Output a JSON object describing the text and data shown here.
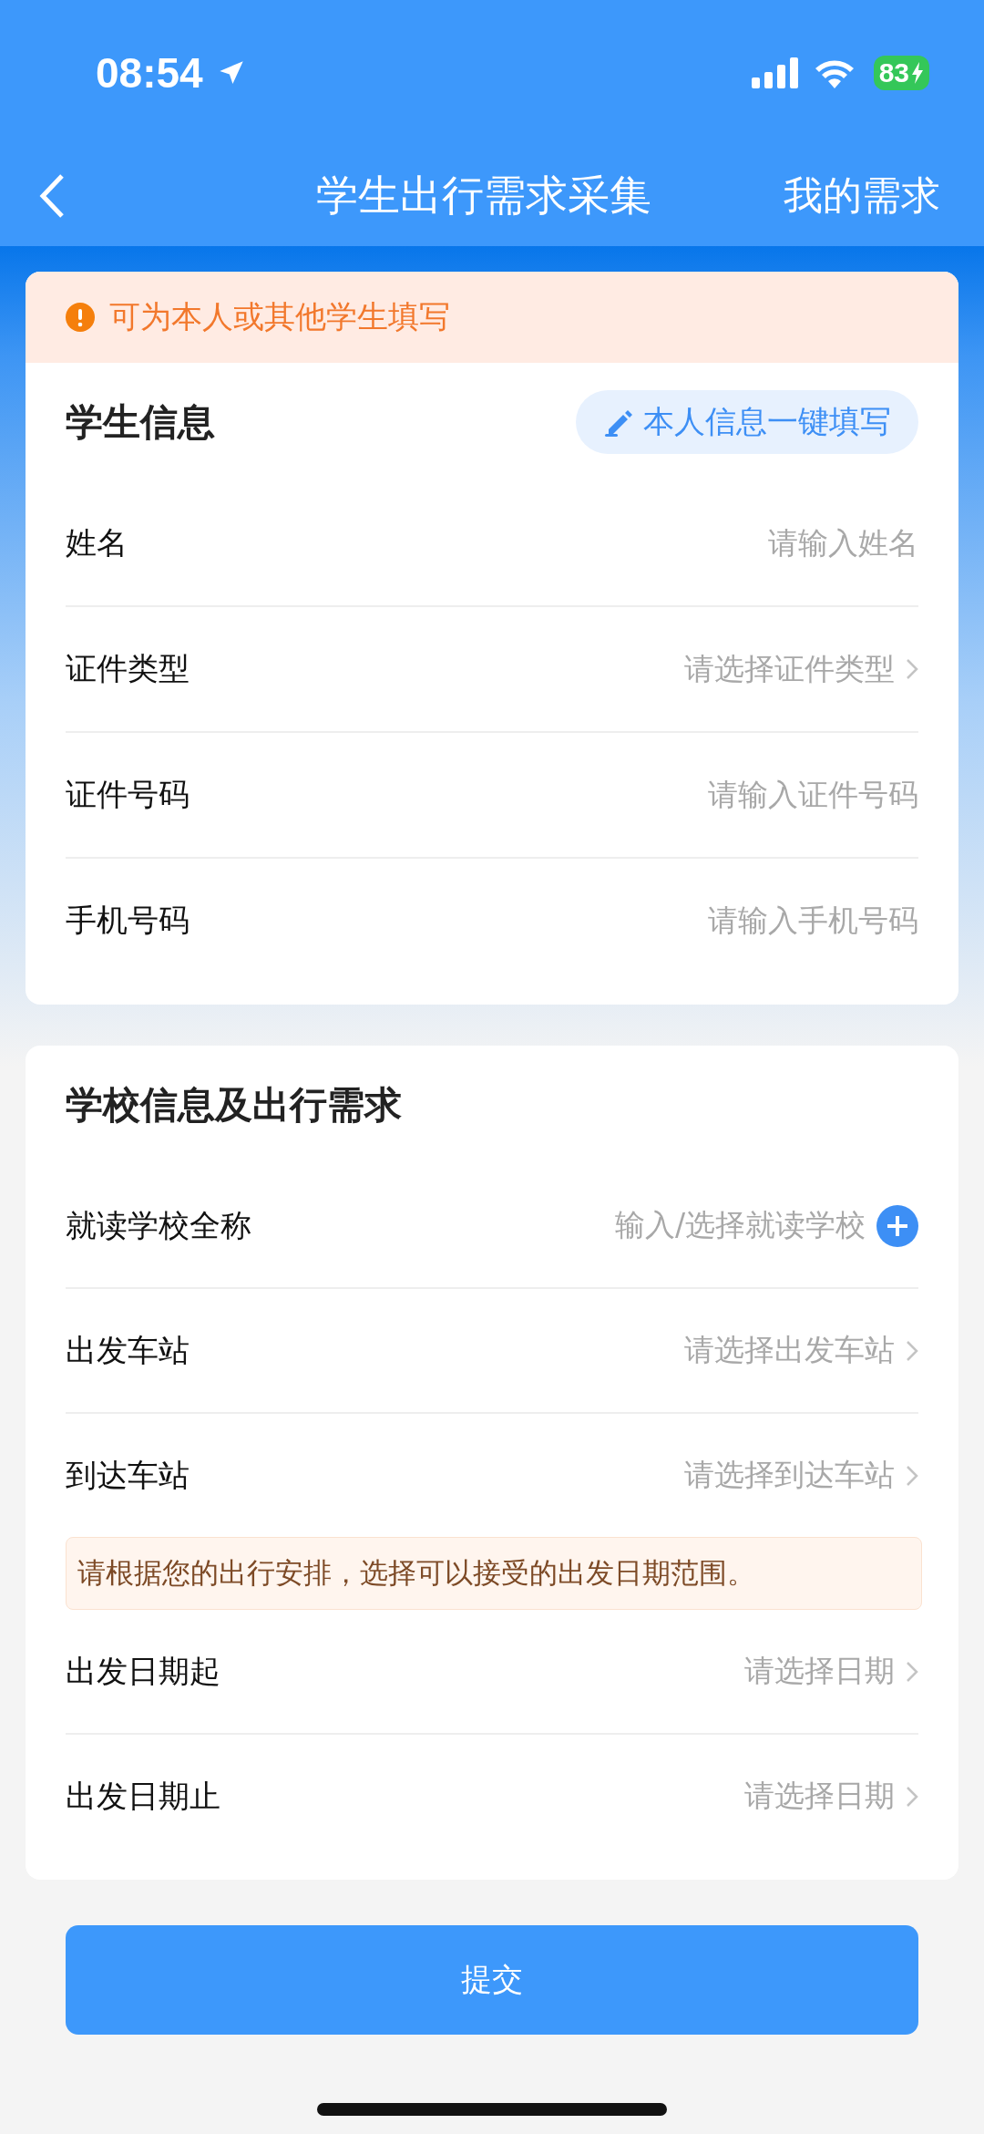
{
  "status_bar": {
    "time": "08:54",
    "battery": "83"
  },
  "nav": {
    "title": "学生出行需求采集",
    "action": "我的需求"
  },
  "notice": "可为本人或其他学生填写",
  "student": {
    "title": "学生信息",
    "autofill": "本人信息一键填写",
    "fields": [
      {
        "label": "姓名",
        "kind": "input",
        "placeholder": "请输入姓名"
      },
      {
        "label": "证件类型",
        "kind": "select",
        "placeholder": "请选择证件类型"
      },
      {
        "label": "证件号码",
        "kind": "input",
        "placeholder": "请输入证件号码"
      },
      {
        "label": "手机号码",
        "kind": "input",
        "placeholder": "请输入手机号码"
      }
    ]
  },
  "school": {
    "title": "学校信息及出行需求",
    "fields": [
      {
        "label": "就读学校全称",
        "kind": "add",
        "placeholder": "输入/选择就读学校"
      },
      {
        "label": "出发车站",
        "kind": "select",
        "placeholder": "请选择出发车站"
      },
      {
        "label": "到达车站",
        "kind": "select",
        "placeholder": "请选择到达车站"
      },
      {
        "kind": "hint",
        "text": "请根据您的出行安排，选择可以接受的出发日期范围。"
      },
      {
        "label": "出发日期起",
        "kind": "select",
        "placeholder": "请选择日期"
      },
      {
        "label": "出发日期止",
        "kind": "select",
        "placeholder": "请选择日期"
      }
    ]
  },
  "submit": "提交"
}
